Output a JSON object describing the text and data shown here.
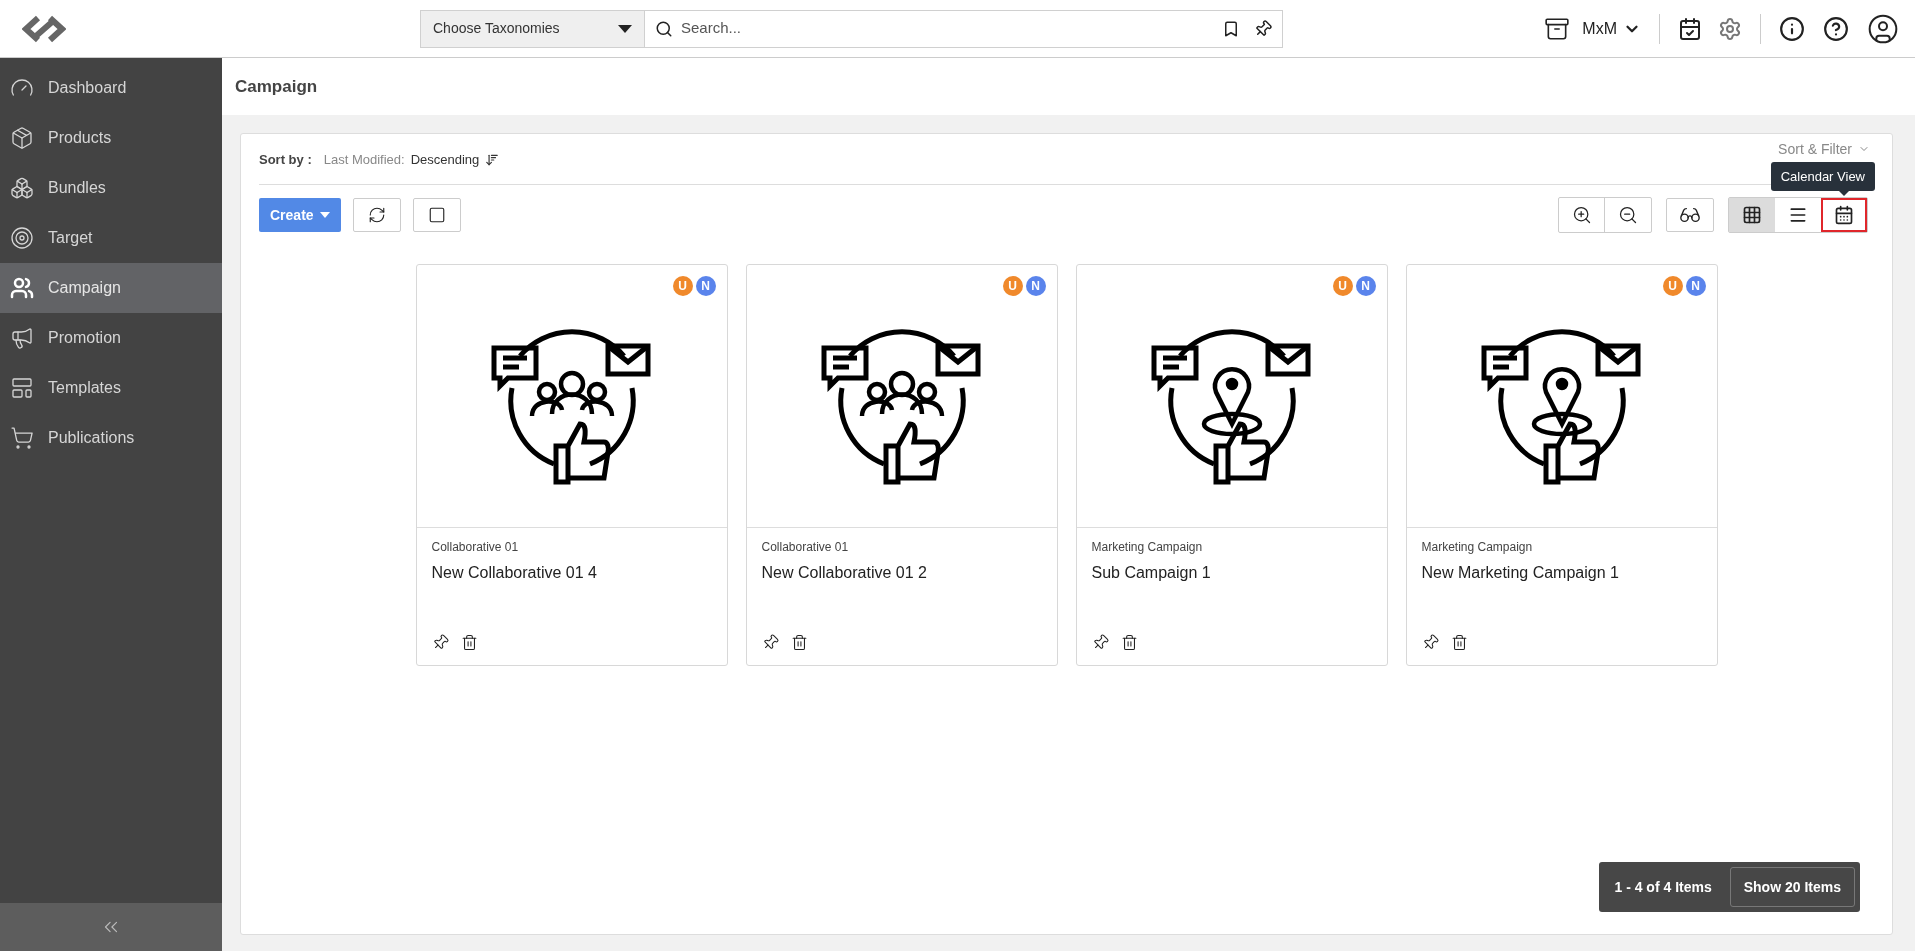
{
  "header": {
    "taxonomy_select": {
      "value": "Choose Taxonomies"
    },
    "search": {
      "placeholder": "Search..."
    },
    "workspace": "MxM"
  },
  "sidebar": {
    "items": [
      {
        "label": "Dashboard",
        "kind": "dashboard",
        "selected": false
      },
      {
        "label": "Products",
        "kind": "products",
        "selected": false
      },
      {
        "label": "Bundles",
        "kind": "bundles",
        "selected": false
      },
      {
        "label": "Target",
        "kind": "target",
        "selected": false
      },
      {
        "label": "Campaign",
        "kind": "campaign",
        "selected": true
      },
      {
        "label": "Promotion",
        "kind": "promotion",
        "selected": false
      },
      {
        "label": "Templates",
        "kind": "templates",
        "selected": false
      },
      {
        "label": "Publications",
        "kind": "publications",
        "selected": false
      }
    ]
  },
  "page_title": "Campaign",
  "sort": {
    "label": "Sort by :",
    "field": "Last Modified:",
    "order": "Descending",
    "menu": "Sort & Filter"
  },
  "toolbar": {
    "create": "Create",
    "select_all": {
      "checked": false
    },
    "tooltip": "Calendar View",
    "views": [
      {
        "kind": "grid",
        "selected": true,
        "highlighted": false
      },
      {
        "kind": "list",
        "selected": false,
        "highlighted": false
      },
      {
        "kind": "calendar",
        "selected": false,
        "highlighted": true
      }
    ]
  },
  "cards": [
    {
      "kind": "people",
      "type": "Collaborative 01",
      "title": "New Collaborative 01 4",
      "badges": [
        {
          "text": "U",
          "color": "#f0892b"
        },
        {
          "text": "N",
          "color": "#5a84ec"
        }
      ]
    },
    {
      "kind": "people",
      "type": "Collaborative 01",
      "title": "New Collaborative 01 2",
      "badges": [
        {
          "text": "U",
          "color": "#f0892b"
        },
        {
          "text": "N",
          "color": "#5a84ec"
        }
      ]
    },
    {
      "kind": "location",
      "type": "Marketing Campaign",
      "title": "Sub Campaign 1",
      "badges": [
        {
          "text": "U",
          "color": "#f0892b"
        },
        {
          "text": "N",
          "color": "#5a84ec"
        }
      ]
    },
    {
      "kind": "location",
      "type": "Marketing Campaign",
      "title": "New Marketing Campaign 1",
      "badges": [
        {
          "text": "U",
          "color": "#f0892b"
        },
        {
          "text": "N",
          "color": "#5a84ec"
        }
      ]
    }
  ],
  "pagination": {
    "range": "1 - 4 of 4 Items",
    "page_size": "Show 20 Items"
  }
}
